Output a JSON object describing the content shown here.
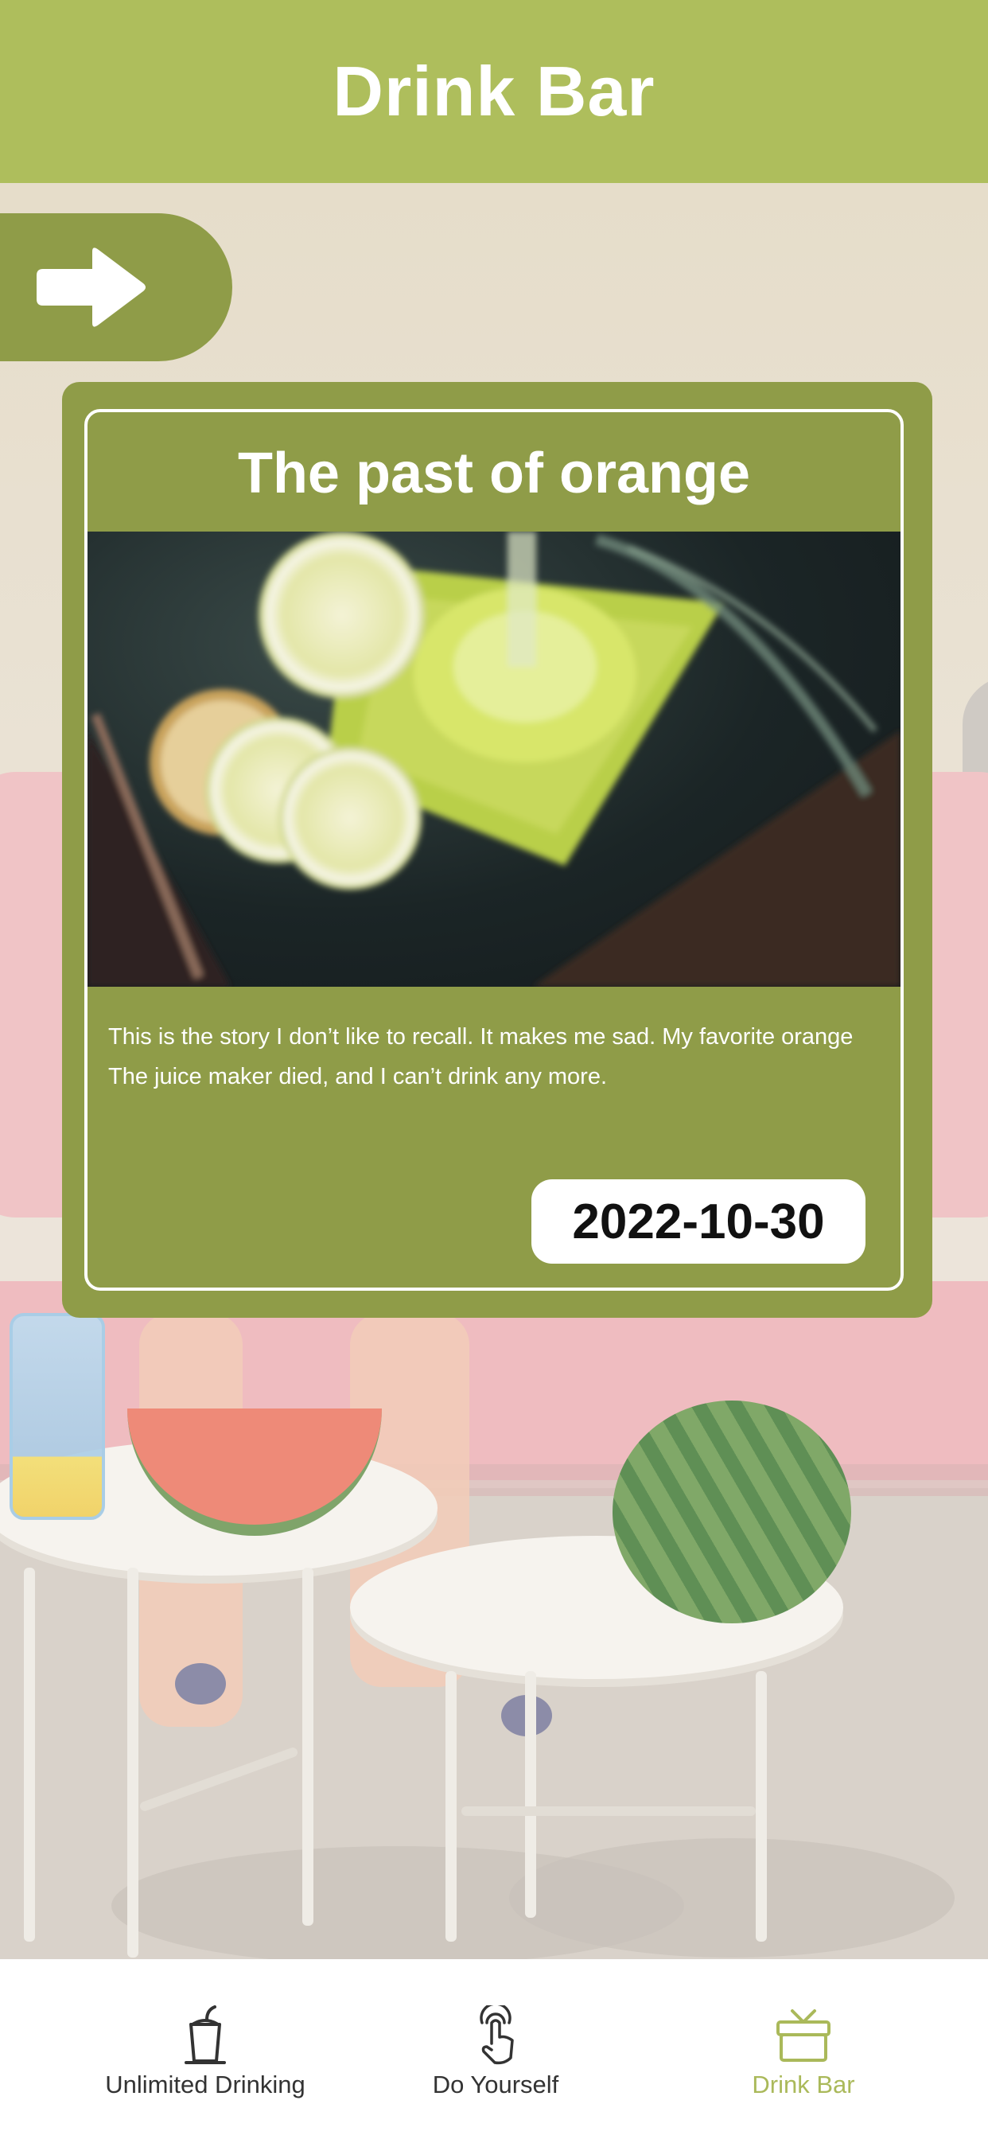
{
  "header": {
    "title": "Drink Bar"
  },
  "back_button": {
    "icon": "arrow-right-icon"
  },
  "card": {
    "title": "The past of orange",
    "image_alt": "Lemon slices and a glass of green drink on a dark cloth",
    "body_line1": "This is the story I don’t like to recall. It makes me sad. My favorite orange",
    "body_line2": "The juice maker died, and I can’t drink any more.",
    "date": "2022-10-30"
  },
  "tabbar": {
    "tabs": [
      {
        "label": "Unlimited Drinking",
        "icon": "cup-icon",
        "active": false
      },
      {
        "label": "Do Yourself",
        "icon": "tap-hand-icon",
        "active": false
      },
      {
        "label": "Drink Bar",
        "icon": "gift-box-icon",
        "active": true
      }
    ]
  },
  "colors": {
    "header": "#aebe5c",
    "card": "#8f9c48",
    "active_tab": "#aab95a",
    "inactive_tab": "#333333"
  }
}
